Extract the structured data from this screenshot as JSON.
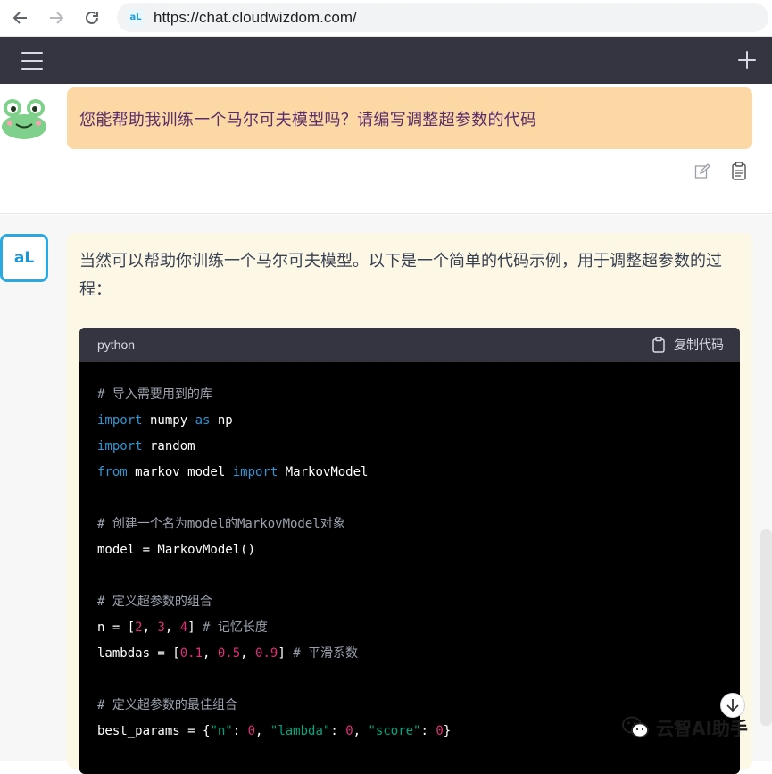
{
  "browser": {
    "url": "https://chat.cloudwizdom.com/",
    "site_icon_text": "aL"
  },
  "user_message": {
    "text": "您能帮助我训练一个马尔可夫模型吗？请编写调整超参数的代码"
  },
  "assistant_message": {
    "avatar_text": "aL",
    "intro": "当然可以帮助你训练一个马尔可夫模型。以下是一个简单的代码示例，用于调整超参数的过程：",
    "code": {
      "language": "python",
      "copy_label": "复制代码",
      "lines": [
        [
          {
            "t": "# 导入需要用到的库",
            "c": "c"
          }
        ],
        [
          {
            "t": "import",
            "c": "k"
          },
          {
            "t": " numpy ",
            "c": ""
          },
          {
            "t": "as",
            "c": "k"
          },
          {
            "t": " np",
            "c": ""
          }
        ],
        [
          {
            "t": "import",
            "c": "k"
          },
          {
            "t": " random",
            "c": ""
          }
        ],
        [
          {
            "t": "from",
            "c": "k"
          },
          {
            "t": " markov_model ",
            "c": ""
          },
          {
            "t": "import",
            "c": "k"
          },
          {
            "t": " MarkovModel",
            "c": ""
          }
        ],
        [],
        [
          {
            "t": "# 创建一个名为model的MarkovModel对象",
            "c": "c"
          }
        ],
        [
          {
            "t": "model = MarkovModel()",
            "c": ""
          }
        ],
        [],
        [
          {
            "t": "# 定义超参数的组合",
            "c": "c"
          }
        ],
        [
          {
            "t": "n = [",
            "c": ""
          },
          {
            "t": "2",
            "c": "n"
          },
          {
            "t": ", ",
            "c": ""
          },
          {
            "t": "3",
            "c": "n"
          },
          {
            "t": ", ",
            "c": ""
          },
          {
            "t": "4",
            "c": "n"
          },
          {
            "t": "] ",
            "c": ""
          },
          {
            "t": "# 记忆长度",
            "c": "c"
          }
        ],
        [
          {
            "t": "lambdas = [",
            "c": ""
          },
          {
            "t": "0.1",
            "c": "n"
          },
          {
            "t": ", ",
            "c": ""
          },
          {
            "t": "0.5",
            "c": "n"
          },
          {
            "t": ", ",
            "c": ""
          },
          {
            "t": "0.9",
            "c": "n"
          },
          {
            "t": "] ",
            "c": ""
          },
          {
            "t": "# 平滑系数",
            "c": "c"
          }
        ],
        [],
        [
          {
            "t": "# 定义超参数的最佳组合",
            "c": "c"
          }
        ],
        [
          {
            "t": "best_params = {",
            "c": ""
          },
          {
            "t": "\"n\"",
            "c": "s"
          },
          {
            "t": ": ",
            "c": ""
          },
          {
            "t": "0",
            "c": "n"
          },
          {
            "t": ", ",
            "c": ""
          },
          {
            "t": "\"lambda\"",
            "c": "s"
          },
          {
            "t": ": ",
            "c": ""
          },
          {
            "t": "0",
            "c": "n"
          },
          {
            "t": ", ",
            "c": ""
          },
          {
            "t": "\"score\"",
            "c": "s"
          },
          {
            "t": ": ",
            "c": ""
          },
          {
            "t": "0",
            "c": "n"
          },
          {
            "t": "}",
            "c": ""
          }
        ]
      ]
    }
  },
  "watermark": {
    "text": "云智AI助手"
  },
  "colors": {
    "header_bg": "#343541",
    "user_bubble_bg": "#fcd8a5",
    "assistant_bubble_bg": "#fdf8e6",
    "code_bg": "#000000",
    "keyword": "#2e95d3",
    "number": "#df3079",
    "string": "#00a67d",
    "comment": "#9ca3af"
  }
}
